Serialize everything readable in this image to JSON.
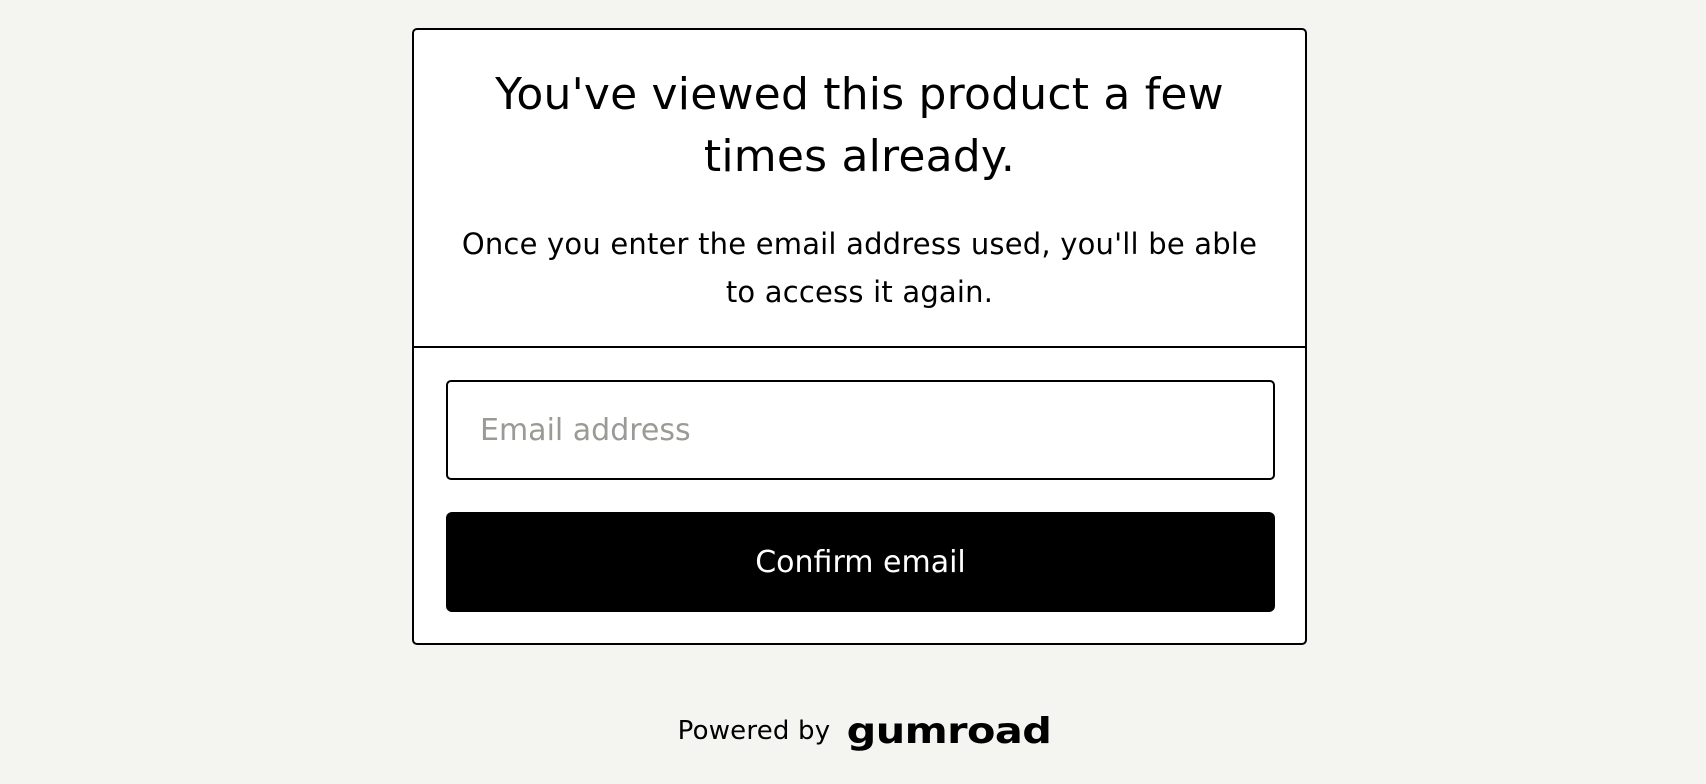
{
  "modal": {
    "title": "You've viewed this product a few times already.",
    "subtitle": "Once you enter the email address used, you'll be able to access it again.",
    "email_placeholder": "Email address",
    "email_value": "",
    "confirm_label": "Confirm email"
  },
  "footer": {
    "powered_by": "Powered by",
    "brand": "GUMROAD"
  },
  "colors": {
    "background": "#f4f4f0",
    "card": "#ffffff",
    "border": "#000000",
    "button": "#000000",
    "button_text": "#ffffff",
    "placeholder": "#9a9a96"
  }
}
